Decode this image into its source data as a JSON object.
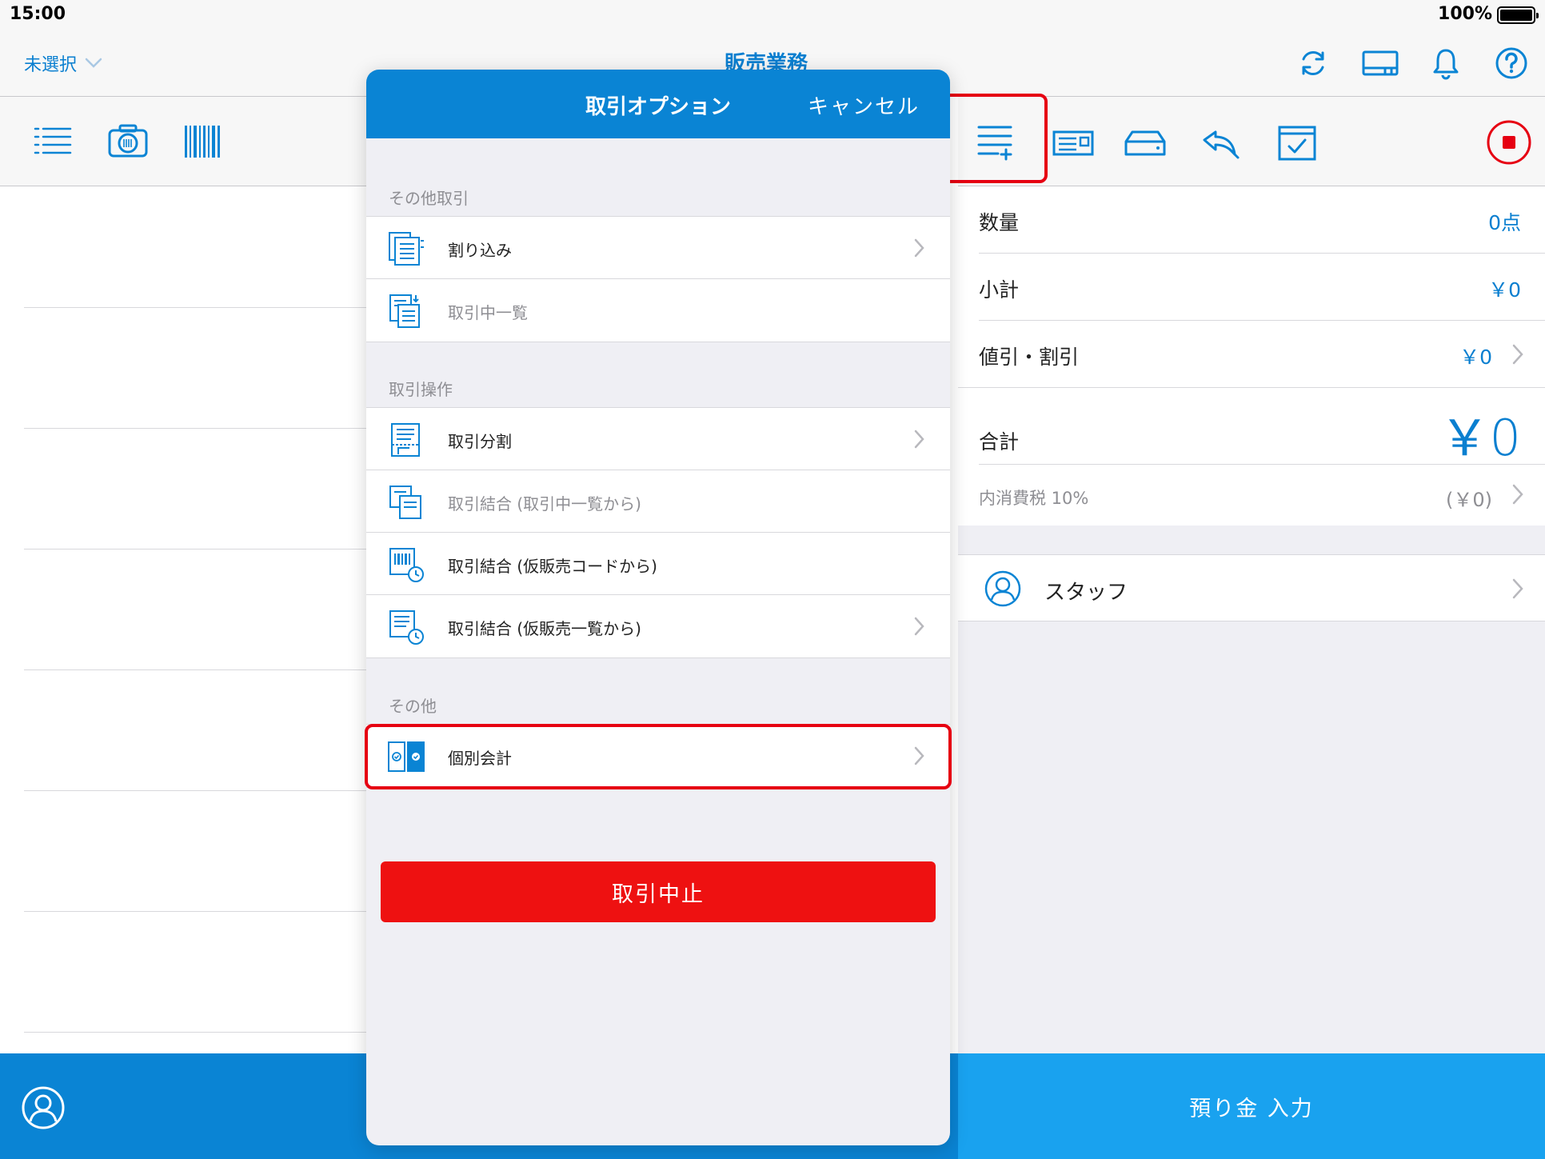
{
  "status_bar": {
    "time": "15:00",
    "battery": "100%"
  },
  "nav": {
    "store_select": "未選択",
    "title": "販売業務"
  },
  "modal": {
    "title": "取引オプション",
    "cancel_label": "キャンセル",
    "sections": [
      {
        "title": "その他取引",
        "items": [
          {
            "label": "割り込み",
            "disabled": false,
            "chevron": true,
            "icon": "interrupt-icon"
          },
          {
            "label": "取引中一覧",
            "disabled": true,
            "chevron": false,
            "icon": "transaction-list-icon"
          }
        ]
      },
      {
        "title": "取引操作",
        "items": [
          {
            "label": "取引分割",
            "disabled": false,
            "chevron": true,
            "icon": "split-icon"
          },
          {
            "label": "取引結合 (取引中一覧から)",
            "disabled": true,
            "chevron": false,
            "icon": "merge-icon"
          },
          {
            "label": "取引結合 (仮販売コードから)",
            "disabled": false,
            "chevron": false,
            "icon": "merge-barcode-icon"
          },
          {
            "label": "取引結合 (仮販売一覧から)",
            "disabled": false,
            "chevron": true,
            "icon": "merge-list-icon"
          }
        ]
      },
      {
        "title": "その他",
        "items": [
          {
            "label": "個別会計",
            "disabled": false,
            "chevron": true,
            "icon": "separate-payment-icon"
          }
        ]
      }
    ],
    "stop_button": "取引中止"
  },
  "summary": {
    "quantity_label": "数量",
    "quantity_value": "0点",
    "subtotal_label": "小計",
    "subtotal_value": "￥0",
    "discount_label": "値引・割引",
    "discount_value": "￥0",
    "total_label": "合計",
    "total_value": "￥0",
    "tax_label": "内消費税 10%",
    "tax_value": "(￥0)",
    "staff_label": "スタッフ"
  },
  "deposit_button": "預り金 入力",
  "colors": {
    "brand_blue": "#0a84d4",
    "accent_blue": "#0a7fd0",
    "deposit_blue": "#19a2ef",
    "stop_red": "#ee1111",
    "highlight_red": "#e60012",
    "background_gray": "#efeff4"
  }
}
